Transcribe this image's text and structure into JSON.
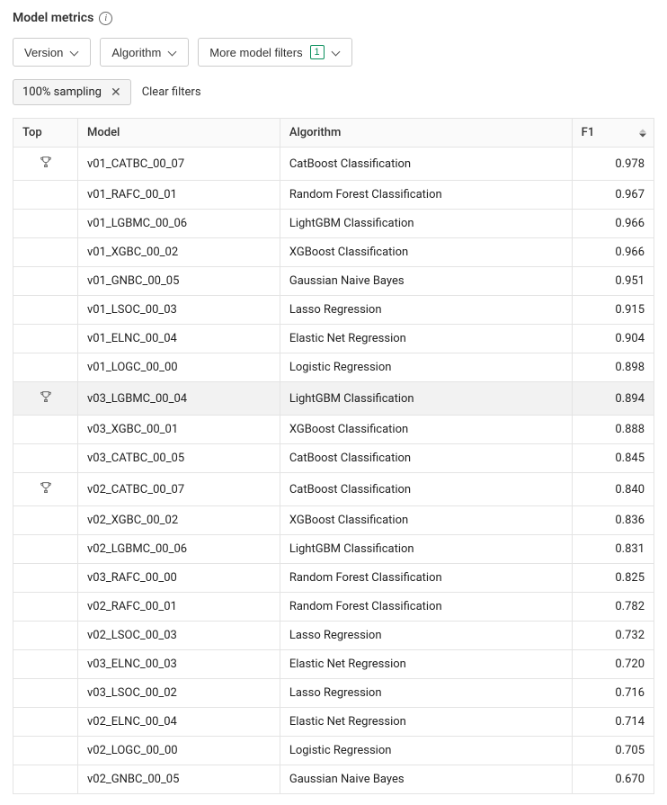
{
  "header": {
    "title": "Model metrics"
  },
  "filters": {
    "version_label": "Version",
    "algorithm_label": "Algorithm",
    "more_label": "More model filters",
    "more_count": "1"
  },
  "chips": {
    "sampling": "100% sampling",
    "clear": "Clear filters"
  },
  "table": {
    "columns": {
      "top": "Top",
      "model": "Model",
      "algorithm": "Algorithm",
      "f1": "F1"
    },
    "rows": [
      {
        "top": true,
        "highlight": false,
        "model": "v01_CATBC_00_07",
        "algorithm": "CatBoost Classification",
        "f1": "0.978"
      },
      {
        "top": false,
        "highlight": false,
        "model": "v01_RAFC_00_01",
        "algorithm": "Random Forest Classification",
        "f1": "0.967"
      },
      {
        "top": false,
        "highlight": false,
        "model": "v01_LGBMC_00_06",
        "algorithm": "LightGBM Classification",
        "f1": "0.966"
      },
      {
        "top": false,
        "highlight": false,
        "model": "v01_XGBC_00_02",
        "algorithm": "XGBoost Classification",
        "f1": "0.966"
      },
      {
        "top": false,
        "highlight": false,
        "model": "v01_GNBC_00_05",
        "algorithm": "Gaussian Naive Bayes",
        "f1": "0.951"
      },
      {
        "top": false,
        "highlight": false,
        "model": "v01_LSOC_00_03",
        "algorithm": "Lasso Regression",
        "f1": "0.915"
      },
      {
        "top": false,
        "highlight": false,
        "model": "v01_ELNC_00_04",
        "algorithm": "Elastic Net Regression",
        "f1": "0.904"
      },
      {
        "top": false,
        "highlight": false,
        "model": "v01_LOGC_00_00",
        "algorithm": "Logistic Regression",
        "f1": "0.898"
      },
      {
        "top": true,
        "highlight": true,
        "model": "v03_LGBMC_00_04",
        "algorithm": "LightGBM Classification",
        "f1": "0.894"
      },
      {
        "top": false,
        "highlight": false,
        "model": "v03_XGBC_00_01",
        "algorithm": "XGBoost Classification",
        "f1": "0.888"
      },
      {
        "top": false,
        "highlight": false,
        "model": "v03_CATBC_00_05",
        "algorithm": "CatBoost Classification",
        "f1": "0.845"
      },
      {
        "top": true,
        "highlight": false,
        "model": "v02_CATBC_00_07",
        "algorithm": "CatBoost Classification",
        "f1": "0.840"
      },
      {
        "top": false,
        "highlight": false,
        "model": "v02_XGBC_00_02",
        "algorithm": "XGBoost Classification",
        "f1": "0.836"
      },
      {
        "top": false,
        "highlight": false,
        "model": "v02_LGBMC_00_06",
        "algorithm": "LightGBM Classification",
        "f1": "0.831"
      },
      {
        "top": false,
        "highlight": false,
        "model": "v03_RAFC_00_00",
        "algorithm": "Random Forest Classification",
        "f1": "0.825"
      },
      {
        "top": false,
        "highlight": false,
        "model": "v02_RAFC_00_01",
        "algorithm": "Random Forest Classification",
        "f1": "0.782"
      },
      {
        "top": false,
        "highlight": false,
        "model": "v02_LSOC_00_03",
        "algorithm": "Lasso Regression",
        "f1": "0.732"
      },
      {
        "top": false,
        "highlight": false,
        "model": "v03_ELNC_00_03",
        "algorithm": "Elastic Net Regression",
        "f1": "0.720"
      },
      {
        "top": false,
        "highlight": false,
        "model": "v03_LSOC_00_02",
        "algorithm": "Lasso Regression",
        "f1": "0.716"
      },
      {
        "top": false,
        "highlight": false,
        "model": "v02_ELNC_00_04",
        "algorithm": "Elastic Net Regression",
        "f1": "0.714"
      },
      {
        "top": false,
        "highlight": false,
        "model": "v02_LOGC_00_00",
        "algorithm": "Logistic Regression",
        "f1": "0.705"
      },
      {
        "top": false,
        "highlight": false,
        "model": "v02_GNBC_00_05",
        "algorithm": "Gaussian Naive Bayes",
        "f1": "0.670"
      }
    ]
  }
}
